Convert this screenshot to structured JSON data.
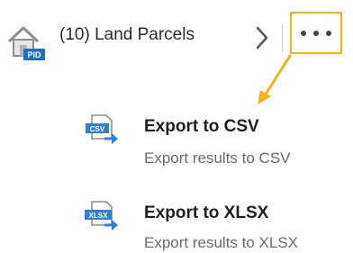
{
  "header": {
    "title": "(10) Land Parcels",
    "pid_badge": "PID",
    "icons": {
      "home": "home-pid-icon",
      "chevron": "chevron-right-icon",
      "more": "more-horizontal-icon"
    }
  },
  "colors": {
    "highlight": "#f1b41a",
    "export_blue": "#2f7fd8"
  },
  "menu": [
    {
      "id": "csv",
      "title": "Export to CSV",
      "subtitle": "Export results to CSV",
      "badge": "CSV",
      "icon": "csv-export-icon"
    },
    {
      "id": "xlsx",
      "title": "Export to XLSX",
      "subtitle": "Export results to XLSX",
      "badge": "XLSX",
      "icon": "xlsx-export-icon"
    }
  ]
}
